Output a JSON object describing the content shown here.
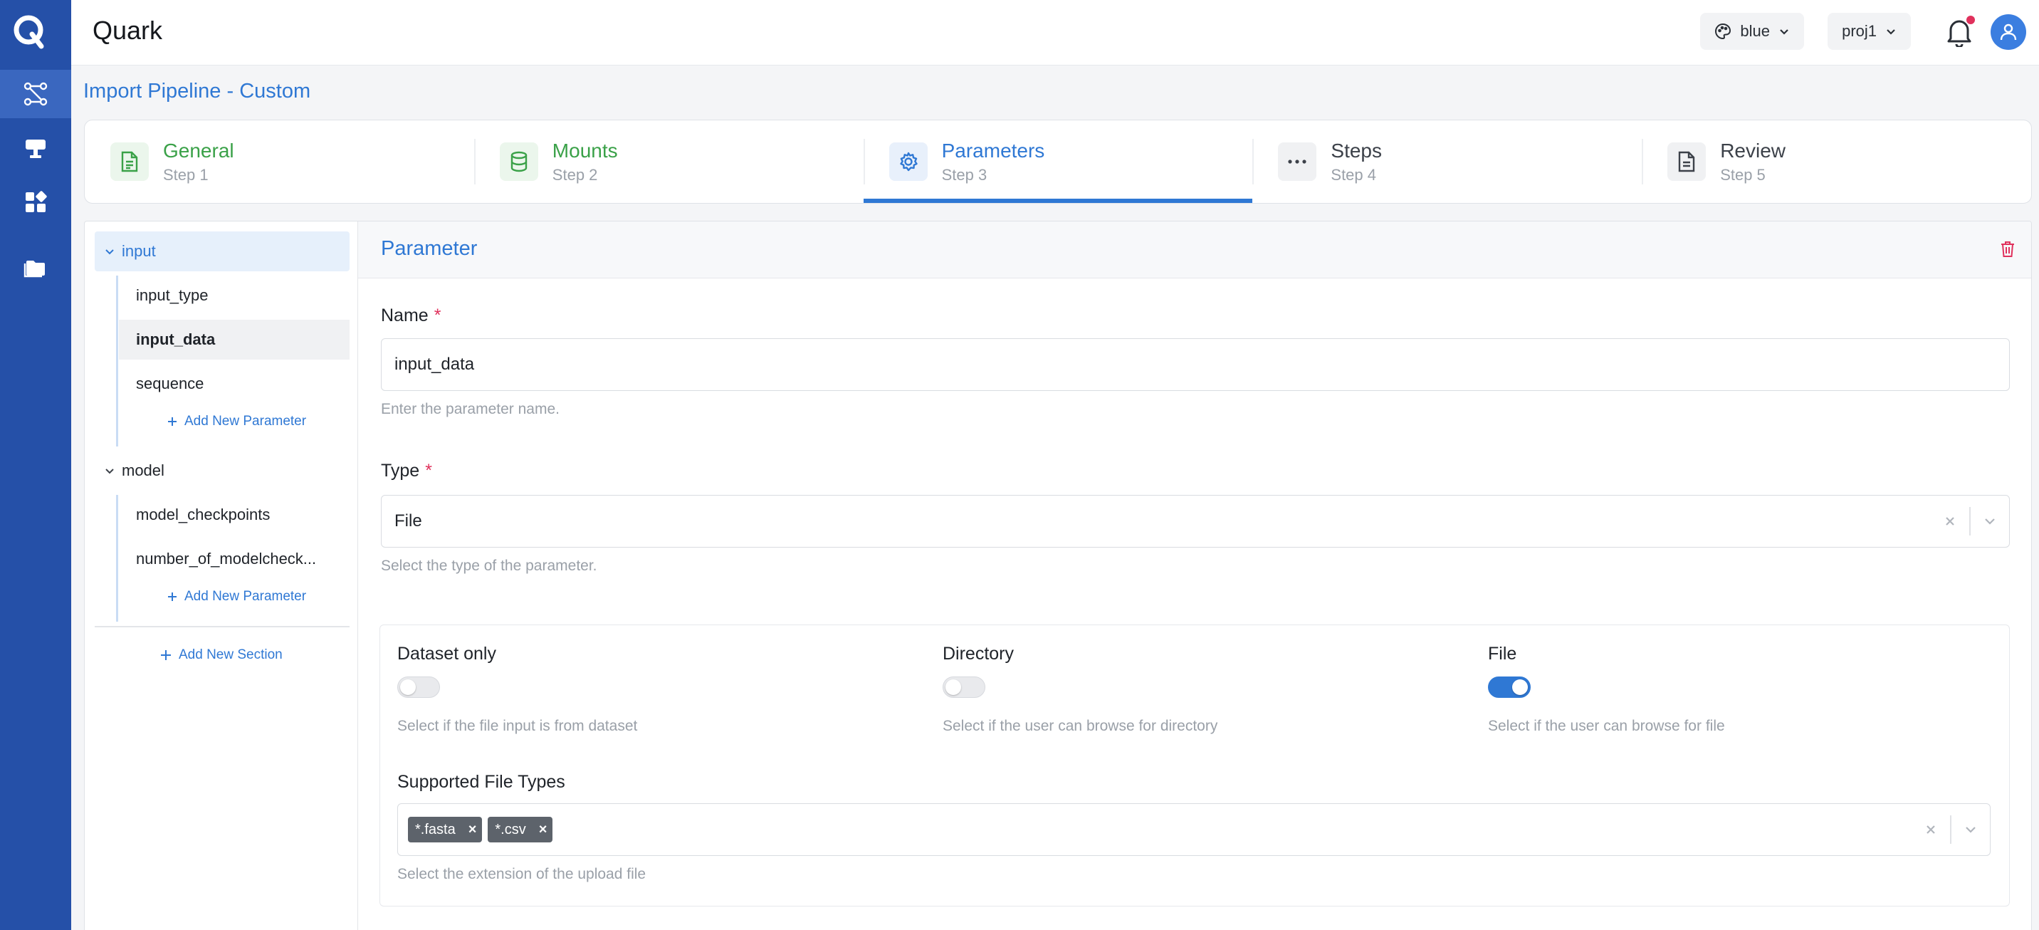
{
  "app": {
    "name": "Quark",
    "logo_letter": "Q"
  },
  "header": {
    "theme_value": "blue",
    "project_value": "proj1"
  },
  "page": {
    "title": "Import Pipeline - Custom"
  },
  "stepper": [
    {
      "title": "General",
      "subtitle": "Step 1",
      "state": "done",
      "icon": "document-icon"
    },
    {
      "title": "Mounts",
      "subtitle": "Step 2",
      "state": "done",
      "icon": "database-icon"
    },
    {
      "title": "Parameters",
      "subtitle": "Step 3",
      "state": "active",
      "icon": "gear-icon"
    },
    {
      "title": "Steps",
      "subtitle": "Step 4",
      "state": "todo",
      "icon": "ellipsis-icon"
    },
    {
      "title": "Review",
      "subtitle": "Step 5",
      "state": "todo",
      "icon": "file-icon"
    }
  ],
  "tree": {
    "sections": [
      {
        "name": "input",
        "items": [
          "input_type",
          "input_data",
          "sequence"
        ]
      },
      {
        "name": "model",
        "items": [
          "model_checkpoints",
          "number_of_modelcheck..."
        ]
      }
    ],
    "add_parameter_label": "Add New Parameter",
    "add_section_label": "Add New Section",
    "selected_item": "input_data"
  },
  "form": {
    "header_title": "Parameter",
    "name": {
      "label": "Name",
      "value": "input_data",
      "help": "Enter the parameter name."
    },
    "type": {
      "label": "Type",
      "value": "File",
      "help": "Select the type of the parameter."
    },
    "options": [
      {
        "label": "Dataset only",
        "on": false,
        "help": "Select if the file input is from dataset"
      },
      {
        "label": "Directory",
        "on": false,
        "help": "Select if the user can browse for directory"
      },
      {
        "label": "File",
        "on": true,
        "help": "Select if the user can browse for file"
      }
    ],
    "file_types": {
      "label": "Supported File Types",
      "values": [
        "*.fasta",
        "*.csv"
      ],
      "help": "Select the extension of the upload file"
    }
  },
  "colors": {
    "rail": "#2550a8",
    "accent": "#2f78d4",
    "success": "#3aa148",
    "danger": "#e0315c"
  }
}
